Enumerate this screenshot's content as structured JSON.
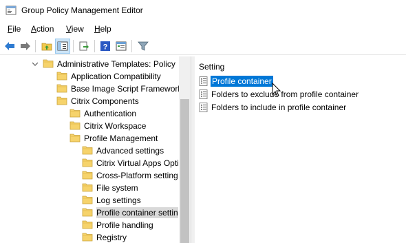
{
  "window": {
    "title": "Group Policy Management Editor",
    "app_icon": "group-policy-icon"
  },
  "menu": {
    "items": [
      {
        "label": "File",
        "mnemonic": "F",
        "rest": "ile"
      },
      {
        "label": "Action",
        "mnemonic": "A",
        "rest": "ction"
      },
      {
        "label": "View",
        "mnemonic": "V",
        "rest": "iew"
      },
      {
        "label": "Help",
        "mnemonic": "H",
        "rest": "elp"
      }
    ]
  },
  "toolbar": {
    "buttons": [
      "back-icon",
      "forward-icon",
      "up-folder-icon",
      "show-hide-tree-icon",
      "export-list-icon",
      "help-icon",
      "properties-icon",
      "filter-icon"
    ],
    "pressed": "show-hide-tree-icon"
  },
  "tree": {
    "items": [
      {
        "label": "Administrative Templates: Policy",
        "expanded": true,
        "has_children": true
      },
      {
        "label": "Application Compatibility",
        "expanded": false,
        "has_children": false
      },
      {
        "label": "Base Image Script Framework",
        "expanded": false,
        "has_children": true
      },
      {
        "label": "Citrix Components",
        "expanded": true,
        "has_children": true
      },
      {
        "label": "Authentication",
        "expanded": false,
        "has_children": false
      },
      {
        "label": "Citrix Workspace",
        "expanded": false,
        "has_children": true
      },
      {
        "label": "Profile Management",
        "expanded": true,
        "has_children": true
      },
      {
        "label": "Advanced settings",
        "expanded": false,
        "has_children": false
      },
      {
        "label": "Citrix Virtual Apps Opti",
        "expanded": false,
        "has_children": false
      },
      {
        "label": "Cross-Platform setting",
        "expanded": false,
        "has_children": false
      },
      {
        "label": "File system",
        "expanded": false,
        "has_children": true
      },
      {
        "label": "Log settings",
        "expanded": false,
        "has_children": false
      },
      {
        "label": "Profile container settin",
        "expanded": false,
        "has_children": false,
        "selected": true
      },
      {
        "label": "Profile handling",
        "expanded": false,
        "has_children": false
      },
      {
        "label": "Registry",
        "expanded": false,
        "has_children": false
      }
    ]
  },
  "list": {
    "header": "Setting",
    "rows": [
      {
        "label": "Profile container",
        "selected": true
      },
      {
        "label": "Folders to exclude from profile container",
        "selected": false
      },
      {
        "label": "Folders to include in profile container",
        "selected": false
      }
    ]
  },
  "colors": {
    "selection_blue": "#0078d7",
    "tree_selection": "#d9d9d9",
    "folder_yellow": "#f2c94c"
  }
}
